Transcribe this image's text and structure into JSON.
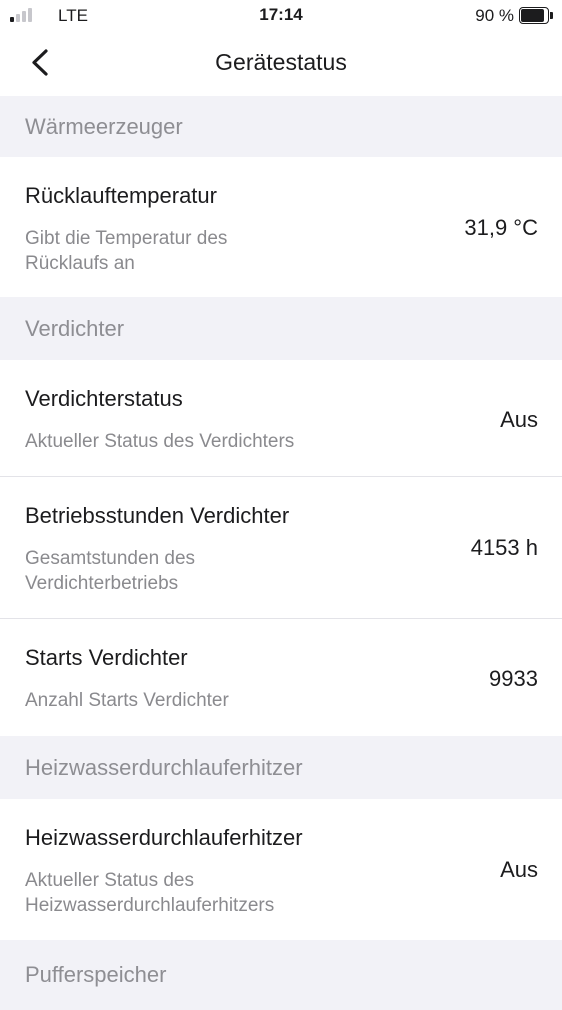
{
  "status_bar": {
    "carrier": "LTE",
    "time": "17:14",
    "battery_percent": "90 %",
    "signal_bars_active": 1,
    "signal_bars_total": 4,
    "battery_level": 0.9
  },
  "nav": {
    "title": "Gerätestatus",
    "back_icon": "chevron-left-icon"
  },
  "sections": [
    {
      "header": "Wärmeerzeuger",
      "rows": [
        {
          "title": "Rücklauftemperatur",
          "description_lines": [
            "Gibt die Temperatur des",
            "Rücklaufs an"
          ],
          "value": "31,9 °C"
        }
      ]
    },
    {
      "header": "Verdichter",
      "rows": [
        {
          "title": "Verdichterstatus",
          "description_lines": [
            "Aktueller Status des Verdichters"
          ],
          "value": "Aus"
        },
        {
          "title": "Betriebsstunden Verdichter",
          "description_lines": [
            "Gesamtstunden des",
            "Verdichterbetriebs"
          ],
          "value": "4153 h"
        },
        {
          "title": "Starts Verdichter",
          "description_lines": [
            "Anzahl Starts Verdichter"
          ],
          "value": "9933"
        }
      ]
    },
    {
      "header": "Heizwasserdurchlauferhitzer",
      "rows": [
        {
          "title": "Heizwasserdurchlauferhitzer",
          "description_lines": [
            "Aktueller Status des",
            "Heizwasserdurchlauferhitzers"
          ],
          "value": "Aus"
        }
      ]
    },
    {
      "header": "Pufferspeicher",
      "rows": []
    }
  ]
}
